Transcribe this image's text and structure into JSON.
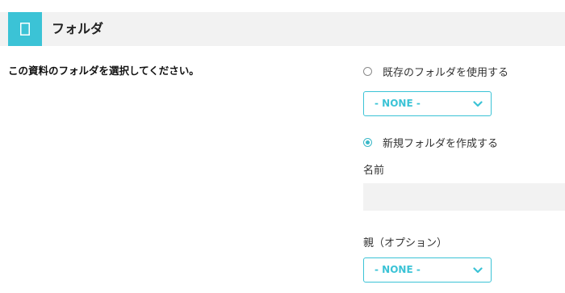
{
  "header": {
    "title": "フォルダ",
    "icon": "folder-icon",
    "icon_bg_color": "#3bc3d6"
  },
  "instruction": "この資料のフォルダを選択してください。",
  "options": {
    "existing": {
      "label": "既存のフォルダを使用する",
      "selected": false,
      "select_value": "- NONE -"
    },
    "new": {
      "label": "新規フォルダを作成する",
      "selected": true,
      "name_label": "名前",
      "name_value": "",
      "parent_label": "親（オプション）",
      "parent_value": "- NONE -"
    }
  },
  "accent_color": "#3bc3d6"
}
